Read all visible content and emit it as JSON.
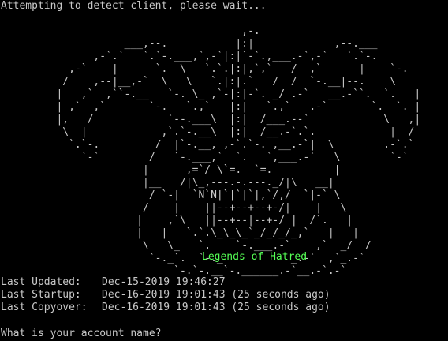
{
  "terminal": {
    "status_line": "Attempting to detect client, please wait...",
    "ascii_art": "                                       ,-.\n                    ___,--.           |:|             ,--.___\n               ,-`.`   `.`-.___,`,-`|:|`-`.,___.-`,-`   `.`-.\n           ,-`    |      `.  \\   `.`.|:|,`,`   /  ,`      |    `-.\n          /    ,--|__,-`  \\   \\   `.|:|.`   /  /  `-.__|--.    \\\n         |   ,`  ,``-.__   `-. \\_ ,`-|:|-`. _/ .-`   __.-``.  `.   |\n         | ,`  ,`       `-.   `.,`   |:|   `.,`   .-`       `.  `. |\n         |,   /            `--.___\\  |:|  /___.--`            \\   ,|\n          \\  |            ,`.`-.__\\  |:|  /__.-`.`.            |  /\n           `.`-.         /  |`-.__, ,-`.`-. ,__.-`|  \\        .-`.`\n             `-`        /   `-.___,`  `.   `,___.-`   \\        `-`\n                       |      ,=`/ \\`=.  `=.          |\n                       |__   /|\\_,---.-.---._/|\\   __|\n                        / `-|  `N`N|`|`|`|,`/,/  `|-` \\\n                       /    |    ||--+--+--+-/|    |   \\\n                      |    ,`\\   ||--+--|--+-/ |  /`.   |\n                      |   |   `.`.\\_\\_\\_`_/_/_/_,`   |   |\n                       \\   \\_   `.    `-.___.-`    ,`  _/  /\n                        `-._`.  `-._           _.-`  ,`_.-`\n                            `-.`-.__`-.______.-`__.-`.-`",
    "game_title": "Legends of Hatred",
    "info": [
      {
        "label": "Last Updated:",
        "value": "Dec-15-2019 19:46:27"
      },
      {
        "label": "Last Startup:",
        "value": "Dec-16-2019 19:01:43 (25 seconds ago)"
      },
      {
        "label": "Last Copyover:",
        "value": "Dec-16-2019 19:01:43 (25 seconds ago)"
      }
    ],
    "prompt": "What is your account name?",
    "colors": {
      "background": "#000000",
      "text": "#c8c8c8",
      "title": "#55ff55"
    }
  }
}
